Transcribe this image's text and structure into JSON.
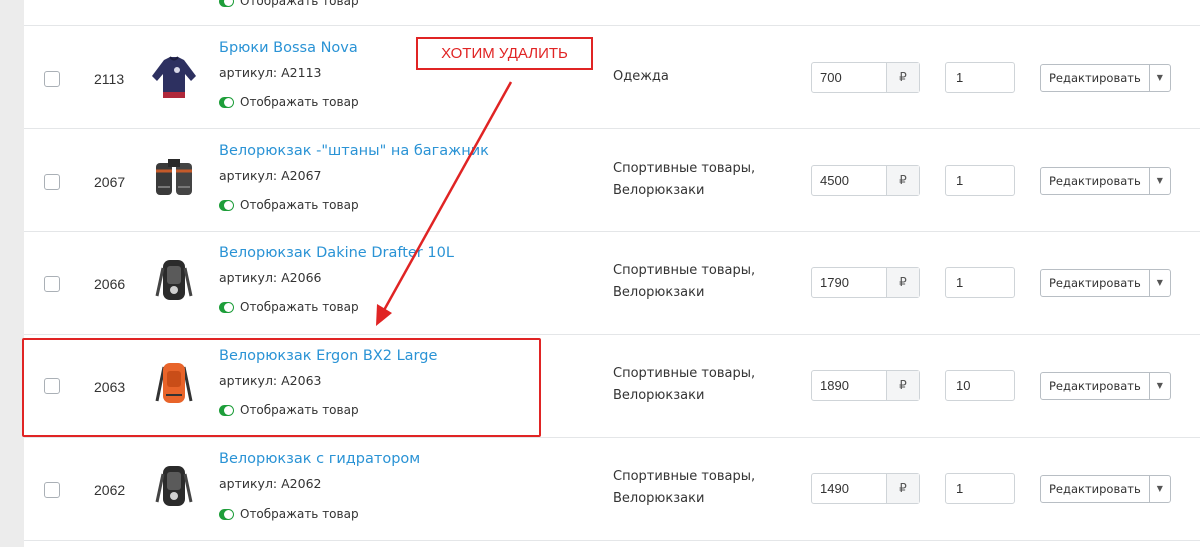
{
  "top_partial": {
    "visibility_label": "Отображать товар"
  },
  "annotation": {
    "callout_text": "ХОТИМ УДАЛИТЬ",
    "color": "#e02424"
  },
  "colors": {
    "link": "#2a93d5",
    "toggle_on": "#1e9e3a"
  },
  "products": [
    {
      "id": "2113",
      "name": "Брюки Bossa Nova",
      "sku": "артикул: A2113",
      "visibility_label": "Отображать товар",
      "category_line1": "Одежда",
      "category_line2": "",
      "price": "700",
      "currency": "₽",
      "quantity": "1",
      "edit_label": "Редактировать",
      "image_icon": "sweater-icon"
    },
    {
      "id": "2067",
      "name": "Велорюкзак -\"штаны\" на багажник",
      "sku": "артикул: A2067",
      "visibility_label": "Отображать товар",
      "category_line1": "Спортивные товары,",
      "category_line2": "Велорюкзаки",
      "price": "4500",
      "currency": "₽",
      "quantity": "1",
      "edit_label": "Редактировать",
      "image_icon": "pannier-bag-icon"
    },
    {
      "id": "2066",
      "name": "Велорюкзак Dakine Drafter 10L",
      "sku": "артикул: A2066",
      "visibility_label": "Отображать товар",
      "category_line1": "Спортивные товары,",
      "category_line2": "Велорюкзаки",
      "price": "1790",
      "currency": "₽",
      "quantity": "1",
      "edit_label": "Редактировать",
      "image_icon": "backpack-icon"
    },
    {
      "id": "2063",
      "name": "Велорюкзак Ergon BX2 Large",
      "sku": "артикул: A2063",
      "visibility_label": "Отображать товар",
      "category_line1": "Спортивные товары,",
      "category_line2": "Велорюкзаки",
      "price": "1890",
      "currency": "₽",
      "quantity": "10",
      "edit_label": "Редактировать",
      "image_icon": "orange-backpack-icon"
    },
    {
      "id": "2062",
      "name": "Велорюкзак с гидратором",
      "sku": "артикул: A2062",
      "visibility_label": "Отображать товар",
      "category_line1": "Спортивные товары,",
      "category_line2": "Велорюкзаки",
      "price": "1490",
      "currency": "₽",
      "quantity": "1",
      "edit_label": "Редактировать",
      "image_icon": "backpack-icon"
    }
  ]
}
